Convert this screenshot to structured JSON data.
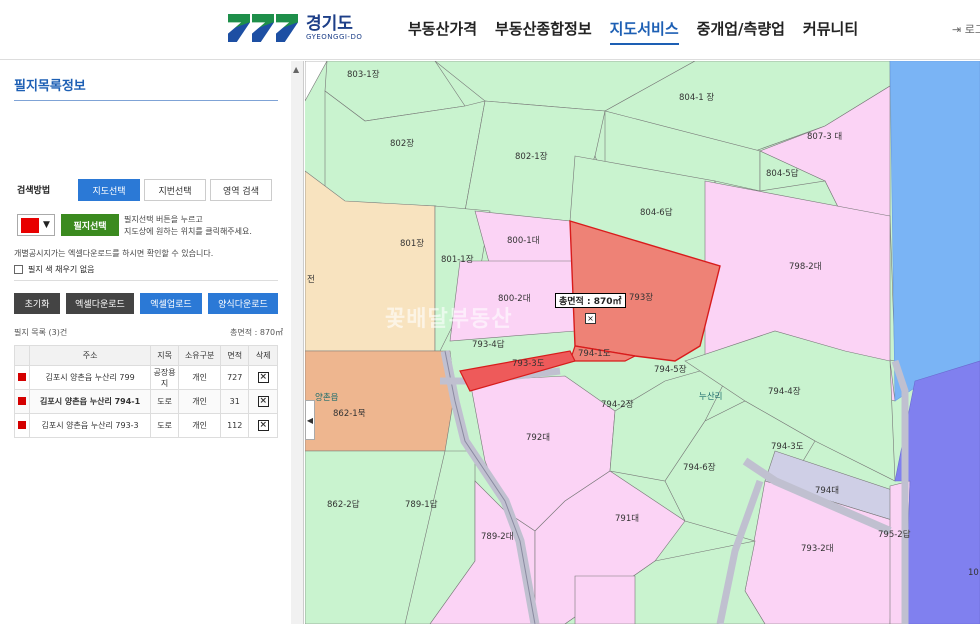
{
  "header": {
    "logo_kr": "경기도",
    "logo_en": "GYEONGGI-DO",
    "nav": [
      "부동산가격",
      "부동산종합정보",
      "지도서비스",
      "중개업/측량업",
      "커뮤니티"
    ],
    "active_nav": "지도서비스",
    "login_label": "로그"
  },
  "panel": {
    "title": "필지목록정보",
    "search_label": "검색방법",
    "tabs": [
      "지도선택",
      "지번선택",
      "영역 검색"
    ],
    "select_color": "#e80000",
    "select_button": "필지선택",
    "help_line1": "필지선택 버튼을 누르고",
    "help_line2": "지도상에 원하는 위치를 클릭해주세요.",
    "note": "개별공시지가는 엑셀다운로드를 하시면 확인할 수 있습니다.",
    "checkbox_label": "필지 색 채우기 없음",
    "buttons": [
      "초기화",
      "엑셀다운로드",
      "엑셀업로드",
      "양식다운로드"
    ],
    "list_count": "필지 목록 (3)건",
    "total_area": "총면적 : 870㎡",
    "table_headers": [
      "주소",
      "지목",
      "소유구분",
      "면적",
      "삭제"
    ],
    "rows": [
      {
        "addr": "김포시 양촌읍 누산리 799",
        "jimok": "공장용지",
        "owner": "개인",
        "area": "727"
      },
      {
        "addr": "김포시 양촌읍 누산리 794-1",
        "jimok": "도로",
        "owner": "개인",
        "area": "31"
      },
      {
        "addr": "김포시 양촌읍 누산리 793-3",
        "jimok": "도로",
        "owner": "개인",
        "area": "112"
      }
    ]
  },
  "map": {
    "callout": "총면적 : 870㎡",
    "watermark": "꽃배달부동산",
    "labels": [
      "803-1장",
      "804-1 장",
      "807-3 대",
      "802장",
      "802-1장",
      "804-5답",
      "804-6답",
      "798-2대",
      "801장",
      "800-1대",
      "801-1장",
      "800-2대",
      "793장",
      "793-4답",
      "793-3도",
      "794-1도",
      "794-5장",
      "794-2장",
      "누산리",
      "794-4장",
      "양촌읍",
      "862-1묵",
      "792대",
      "794-3도",
      "794-6장",
      "794대",
      "862-2답",
      "789-1답",
      "791대",
      "789-2대",
      "793-2대",
      "795-2답",
      "10",
      "전"
    ]
  }
}
